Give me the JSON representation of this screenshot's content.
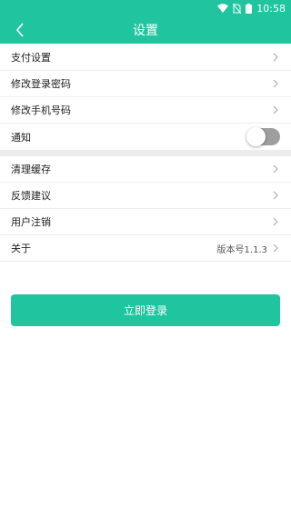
{
  "status_bar": {
    "time": "10:58",
    "icons": [
      "wifi-icon",
      "no-sim-icon",
      "battery-icon"
    ]
  },
  "header": {
    "title": "设置",
    "back_icon": "chevron-left-icon"
  },
  "settings_group_1": [
    {
      "label": "支付设置"
    },
    {
      "label": "修改登录密码"
    },
    {
      "label": "修改手机号码"
    },
    {
      "label": "通知",
      "toggle": false
    }
  ],
  "settings_group_2": [
    {
      "label": "清理缓存"
    },
    {
      "label": "反馈建议"
    },
    {
      "label": "用户注销"
    },
    {
      "label": "关于",
      "value": "版本号1.1.3"
    }
  ],
  "login_button": {
    "label": "立即登录"
  },
  "colors": {
    "accent": "#20c5a0",
    "divider": "#ececec",
    "toggle_off": "#9e9e9e"
  }
}
